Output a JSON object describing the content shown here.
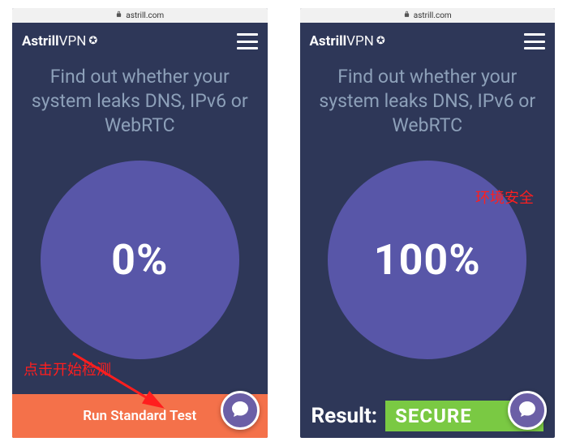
{
  "left": {
    "address": {
      "domain": "astrill.com"
    },
    "brand": {
      "part1": "Astrill",
      "part2": "VPN",
      "badge": "✪"
    },
    "headline": "Find out whether your system leaks DNS, IPv6 or WebRTC",
    "gauge_percent": "0%",
    "annotation": "点击开始检测",
    "cta_label": "Run Standard Test"
  },
  "right": {
    "address": {
      "domain": "astrill.com"
    },
    "brand": {
      "part1": "Astrill",
      "part2": "VPN",
      "badge": "✪"
    },
    "headline": "Find out whether your system leaks DNS, IPv6 or WebRTC",
    "gauge_percent": "100%",
    "annotation": "环境安全",
    "result_label": "Result:",
    "result_value": "SECURE"
  },
  "colors": {
    "bg": "#2E3758",
    "gauge": "#5856A8",
    "cta": "#F4714A",
    "secure": "#7AC943",
    "headline": "#8DA0B9",
    "annot": "#FF1E1E"
  }
}
